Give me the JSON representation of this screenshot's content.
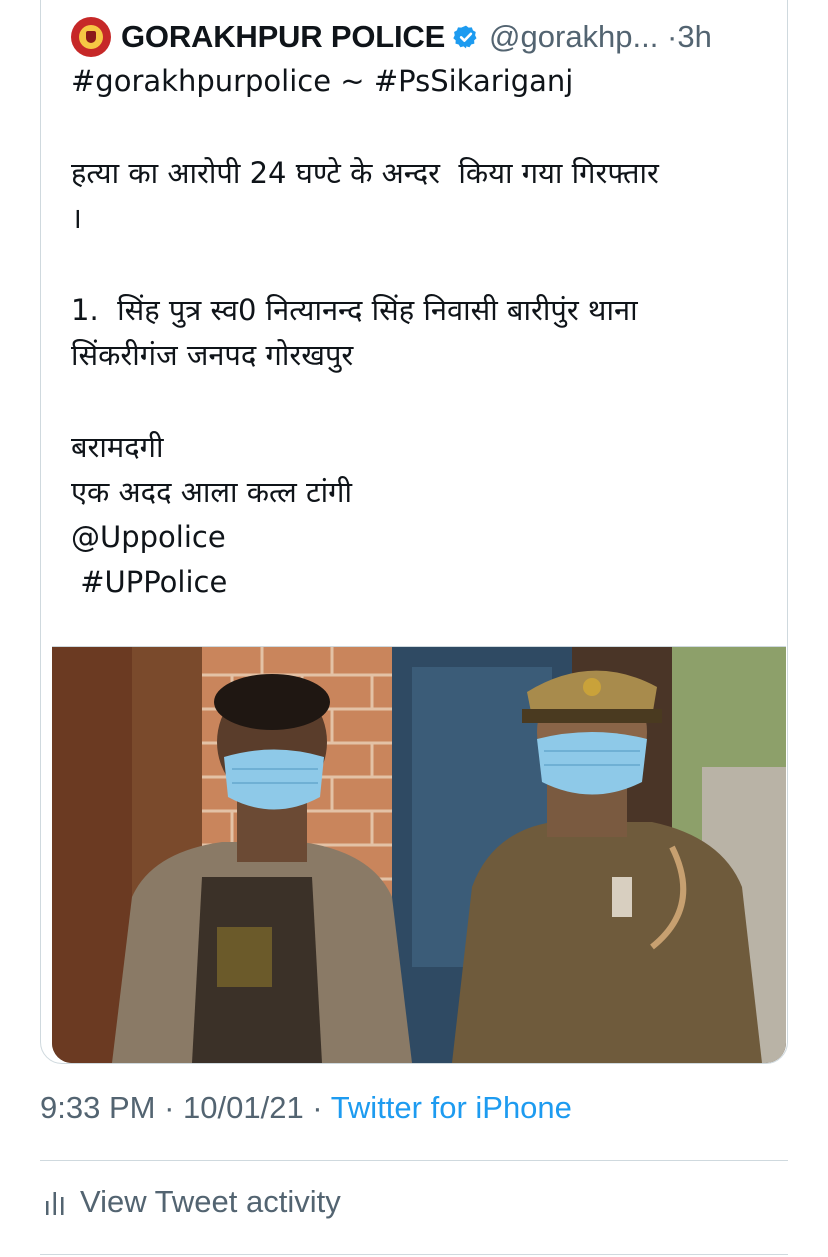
{
  "tweet": {
    "author_name": "GORAKHPUR POLICE",
    "handle": "@gorakhp...",
    "time_ago": "3h",
    "separator": "·",
    "lines": [
      "#gorakhpurpolice ~ #PsSikariganj",
      "",
      "हत्या का आरोपी 24 घण्टे के अन्दर  किया गया गिरफ्तार",
      "।",
      "",
      "1.  सिंह पुत्र स्व0 नित्यानन्द सिंह निवासी बारीपुंर थाना",
      "सिंकरीगंज जनपद गोरखपुर",
      "",
      "बरामदगी",
      "एक अदद आला कत्ल टांगी",
      "@Uppolice",
      " #UPPolice"
    ]
  },
  "meta": {
    "time": "9:33 PM",
    "date": "10/01/21",
    "source": "Twitter for iPhone",
    "sep": " · "
  },
  "activity": {
    "label": "View Tweet activity"
  },
  "colors": {
    "link": "#1d9bf0",
    "muted": "#536471",
    "border": "#cfd9de",
    "badge": "#1d9bf0"
  }
}
